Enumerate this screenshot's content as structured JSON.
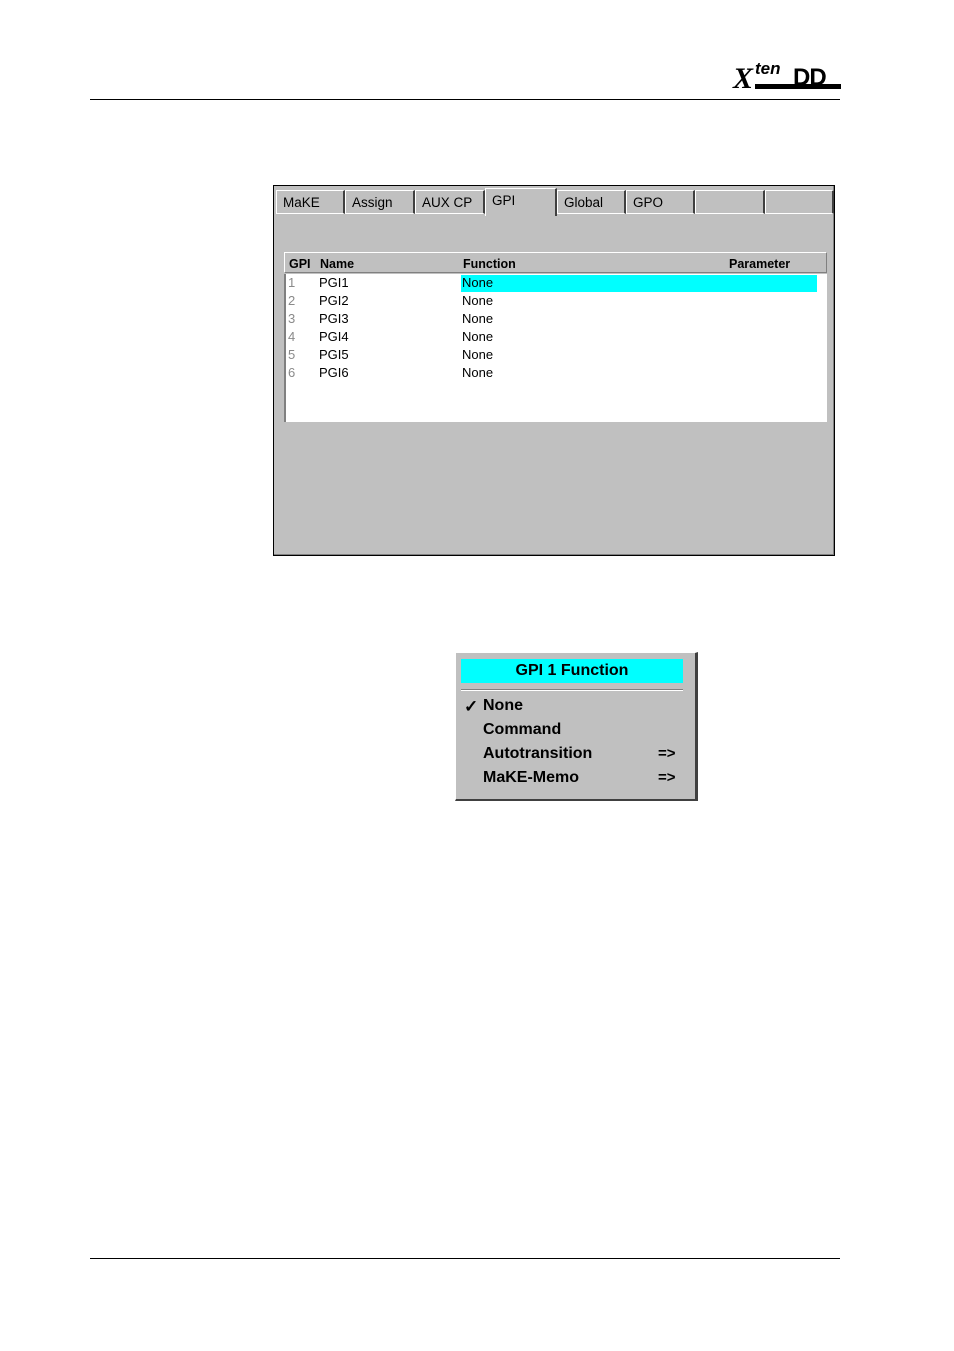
{
  "logo": {
    "x": "X",
    "ten": "ten",
    "dd": "DD"
  },
  "tabs": [
    {
      "label": "MaKE",
      "active": false
    },
    {
      "label": "Assign",
      "active": false
    },
    {
      "label": "AUX CP",
      "active": false
    },
    {
      "label": "GPI",
      "active": true
    },
    {
      "label": "Global",
      "active": false
    },
    {
      "label": "GPO",
      "active": false
    },
    {
      "label": "",
      "active": false
    },
    {
      "label": "",
      "active": false
    }
  ],
  "table": {
    "headers": {
      "gpi": "GPI",
      "name": "Name",
      "function": "Function",
      "parameter": "Parameter"
    },
    "rows": [
      {
        "num": "1",
        "name": "PGI1",
        "function": "None",
        "parameter": "",
        "selected": true
      },
      {
        "num": "2",
        "name": "PGI2",
        "function": "None",
        "parameter": "",
        "selected": false
      },
      {
        "num": "3",
        "name": "PGI3",
        "function": "None",
        "parameter": "",
        "selected": false
      },
      {
        "num": "4",
        "name": "PGI4",
        "function": "None",
        "parameter": "",
        "selected": false
      },
      {
        "num": "5",
        "name": "PGI5",
        "function": "None",
        "parameter": "",
        "selected": false
      },
      {
        "num": "6",
        "name": "PGI6",
        "function": "None",
        "parameter": "",
        "selected": false
      }
    ]
  },
  "popup": {
    "title": "GPI 1  Function",
    "items": [
      {
        "label": "None",
        "checked": true,
        "submenu": ""
      },
      {
        "label": "Command",
        "checked": false,
        "submenu": ""
      },
      {
        "label": "Autotransition",
        "checked": false,
        "submenu": "=>"
      },
      {
        "label": "MaKE-Memo",
        "checked": false,
        "submenu": "=>"
      }
    ],
    "check_glyph": "✓"
  },
  "colors": {
    "highlight": "#00ffff",
    "panel": "#c0c0c0"
  }
}
